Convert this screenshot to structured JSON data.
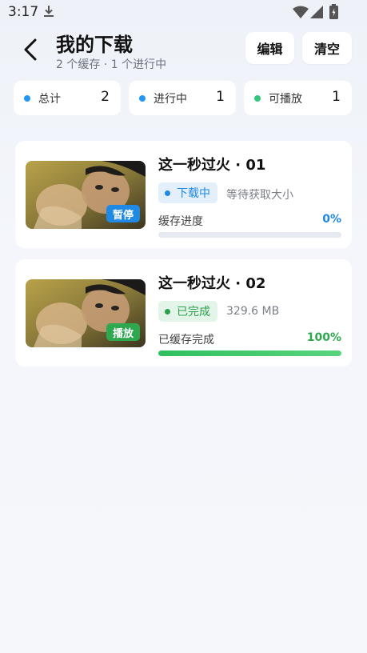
{
  "status_bar": {
    "time": "3:17",
    "icons": [
      "download-icon",
      "wifi-icon",
      "signal-icon",
      "battery-icon"
    ]
  },
  "header": {
    "title": "我的下载",
    "subtitle": "2 个缓存 · 1 个进行中",
    "edit_label": "编辑",
    "clear_label": "清空"
  },
  "stats": [
    {
      "label": "总计",
      "value": "2",
      "color": "#2196f3"
    },
    {
      "label": "进行中",
      "value": "1",
      "color": "#2196f3"
    },
    {
      "label": "可播放",
      "value": "1",
      "color": "#34c77b"
    }
  ],
  "downloads": [
    {
      "title": "这一秒过火 · 01",
      "badge": "暂停",
      "status": "下载中",
      "meta": "等待获取大小",
      "progress_label": "缓存进度",
      "progress_text": "0%",
      "progress": 0
    },
    {
      "title": "这一秒过火 · 02",
      "badge": "播放",
      "status": "已完成",
      "meta": "329.6 MB",
      "progress_label": "已缓存完成",
      "progress_text": "100%",
      "progress": 1
    }
  ],
  "colors": {
    "accent_blue": "#1e88e5",
    "accent_green": "#2ea84f",
    "background": "#f4f6fb"
  }
}
